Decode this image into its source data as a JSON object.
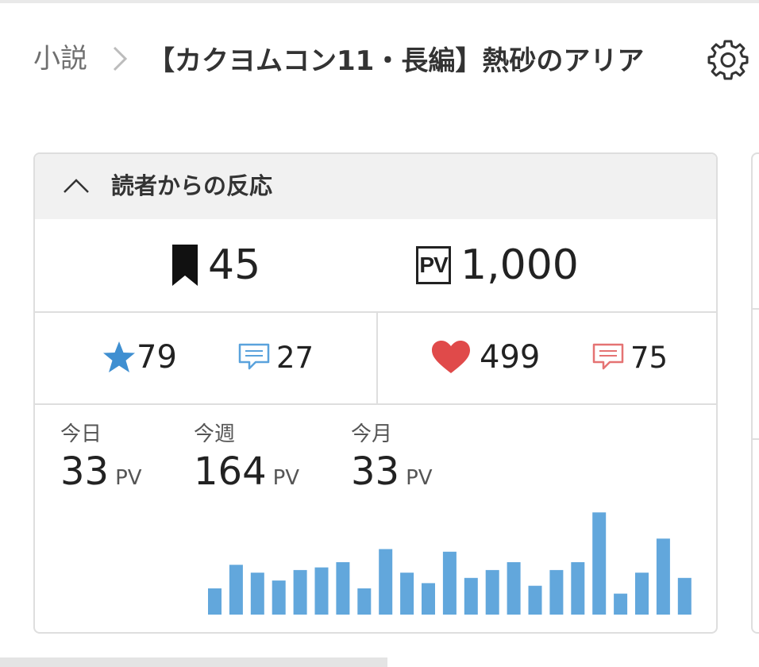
{
  "breadcrumb": {
    "root": "小説",
    "title": "【カクヨムコン11・長編】熱砂のアリア"
  },
  "settings": {
    "icon": "gear-icon"
  },
  "reactions": {
    "title": "読者からの反応",
    "bookmarks": "45",
    "pv_icon_text": "PV",
    "pv_total": "1,000",
    "stars": "79",
    "star_comments": "27",
    "hearts": "499",
    "heart_comments": "75"
  },
  "pv_stats": [
    {
      "label": "今日",
      "value": "33",
      "unit": "PV"
    },
    {
      "label": "今週",
      "value": "164",
      "unit": "PV"
    },
    {
      "label": "今月",
      "value": "33",
      "unit": "PV"
    }
  ],
  "colors": {
    "star": "#3f8fd1",
    "heart": "#e04a4a",
    "star_comment": "#5aa2dc",
    "heart_comment": "#e57373",
    "bar": "#62a7dc"
  },
  "chart_data": {
    "type": "bar",
    "values": [
      10,
      19,
      16,
      13,
      17,
      18,
      20,
      10,
      25,
      16,
      12,
      24,
      14,
      17,
      20,
      11,
      17,
      20,
      39,
      8,
      16,
      29,
      14
    ],
    "ylim": [
      0,
      40
    ],
    "grid": false,
    "xlabel": "",
    "ylabel": ""
  }
}
